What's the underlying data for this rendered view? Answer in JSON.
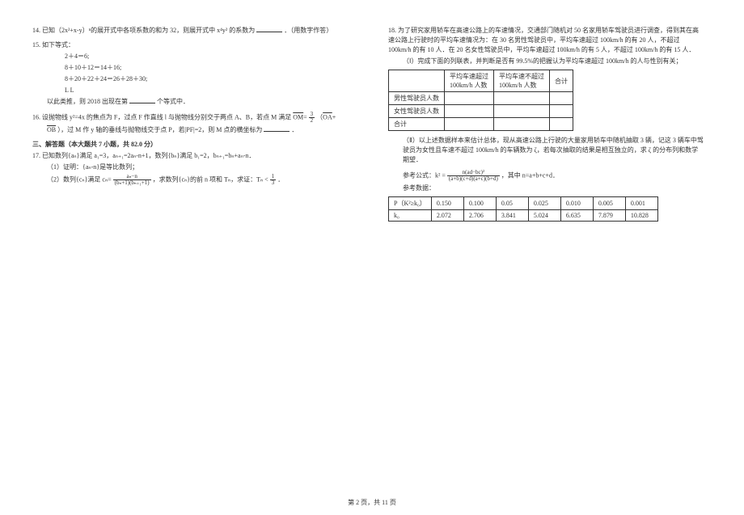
{
  "q14": {
    "label": "14.",
    "text1": "已知（2x²+x-y）ⁿ的展开式中各项系数的和为 32，则展开式中 x⁴y² 的系数为",
    "text2": "．（用数字作答）"
  },
  "q15": {
    "label": "15.",
    "intro": "如下等式：",
    "line1": "2＋4＝6;",
    "line2": "8＋10＋12＝14＋16;",
    "line3": "8＋20＋22＋24＝26＋28＋30;",
    "line4": "L   L",
    "conclusion1": "以此类推，则 2018 出现在第",
    "conclusion2": "个等式中．"
  },
  "q16": {
    "label": "16.",
    "text1": "设抛物线 y²=4x 的焦点为 F，过点 F 作直线 l 与抛物线分别交于两点 A、B，若点 M 满足",
    "vec_om": "OM",
    "frac_main": {
      "num": "3",
      "den": "2"
    },
    "vec_oa": "OA",
    "vec_ob": "OB",
    "text2": "），过 M 作 y 轴的垂线与抛物线交于点 P，若|PF|=2，则 M 点的横坐标为",
    "text3": "．"
  },
  "section3": "三、解答题（本大题共 7 小题，共 82.0 分）",
  "q17": {
    "label": "17.",
    "intro": "已知数列{aₙ}满足 a₁=3，aₙ₊₁=2aₙ-n+1，数列{bₙ}满足 b₁=2，bₙ₊₁=bₙ+aₙ-n．",
    "sub1": "（1）证明：{aₙ-n}是等比数列；",
    "sub2a": "（2）数列{cₙ}满足 cₙ=",
    "frac_c": {
      "num": "aₙ−n",
      "den": "(bₙ+1)(bₙ₊₁+1)"
    },
    "sub2b": "，求数列{cₙ}的前 n 项和 Tₙ，求证：Tₙ <",
    "frac_t": {
      "num": "1",
      "den": "3"
    },
    "sub2c": "．"
  },
  "q18": {
    "label": "18.",
    "p1": "为了研究家用轿车在高速公路上的车速情况，交通部门随机对 50 名家用轿车驾驶员进行调查，得到其在高速公路上行驶时的平均车速情况为：在 30 名男性驾驶员中，平均车速超过 100km/h 的有 20 人，不超过 100km/h 的有 10 人．在 20 名女性驾驶员中，平均车速超过 100km/h 的有 5 人，不超过 100km/h 的有 15 人．",
    "p2": "（Ⅰ）完成下面的列联表，并判断是否有 99.5%的把握认为平均车速超过 100km/h 的人与性别有关；",
    "table1": {
      "h1": "平均车速超过",
      "h1b": "100km/h 人数",
      "h2": "平均车速不超过",
      "h2b": "100km/h 人数",
      "h3": "合计",
      "r1": "男性驾驶员人数",
      "r2": "女性驾驶员人数",
      "r3": "合计"
    },
    "p3": "（Ⅱ）以上述数据样本来估计总体，现从高速公路上行驶的大量家用轿车中随机抽取 3 辆，记这 3 辆车中驾驶员为女性且车速不超过 100km/h 的车辆数为 ζ，若每次抽取的结果是相互独立的，求 ζ 的分布列和数学期望．",
    "formula_label": "参考公式：k² =",
    "formula_frac": {
      "num": "n(ad−bc)²",
      "den": "(a+b)(c+d)(a+c)(b+d)"
    },
    "formula_tail": "，其中 n=a+b+c+d．",
    "ref_label": "参考数据：",
    "table2": {
      "head": [
        "P（K²≥k₀）",
        "0.150",
        "0.100",
        "0.05",
        "0.025",
        "0.010",
        "0.005",
        "0.001"
      ],
      "row": [
        "k₀",
        "2.072",
        "2.706",
        "3.841",
        "5.024",
        "6.635",
        "7.879",
        "10.828"
      ]
    }
  },
  "footer": "第 2 页，共 11 页"
}
